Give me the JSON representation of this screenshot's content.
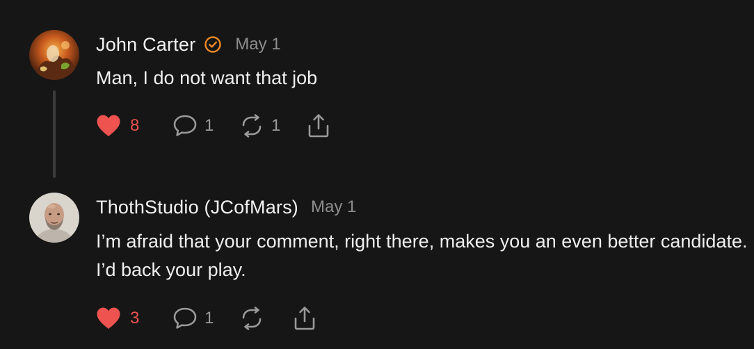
{
  "comments": [
    {
      "author": "John Carter",
      "verified": true,
      "date": "May 1",
      "text": "Man, I do not want that job",
      "likes": "8",
      "replies": "1",
      "reposts": "1",
      "avatar_icon": "fantasy-art-avatar"
    },
    {
      "author": "ThothStudio (JCofMars)",
      "verified": false,
      "date": "May 1",
      "text": "I’m afraid that your comment, right there, makes you an even better candidate. I’d back your play.",
      "likes": "3",
      "replies": "1",
      "reposts": "",
      "avatar_icon": "bald-man-portrait-avatar"
    }
  ],
  "icons": {
    "like": "heart-icon",
    "reply": "speech-bubble-icon",
    "repost": "repost-arrows-icon",
    "share": "share-upload-icon",
    "verified": "verified-check-icon"
  },
  "colors": {
    "background": "#161616",
    "like_active": "#ef5350",
    "verified_badge": "#f08a24",
    "muted_text": "#8e8e8e"
  }
}
